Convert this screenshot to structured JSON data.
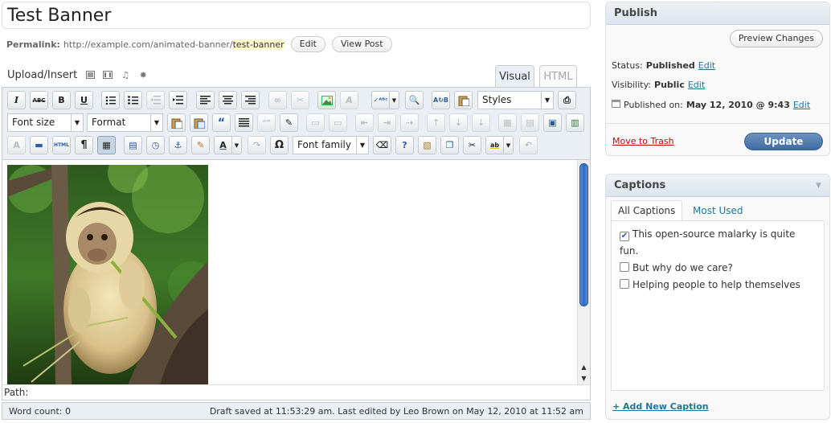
{
  "post": {
    "title": "Test Banner",
    "permalink_label": "Permalink:",
    "permalink_base": "http://example.com/animated-banner/",
    "permalink_slug": "test-banner",
    "edit_label": "Edit",
    "view_post_label": "View Post"
  },
  "editor": {
    "upload_insert_label": "Upload/Insert",
    "tab_visual": "Visual",
    "tab_html": "HTML",
    "styles_label": "Styles",
    "font_size_label": "Font size",
    "format_label": "Format",
    "font_family_label": "Font family",
    "path_label": "Path:",
    "word_count": "Word count: 0",
    "draft_status": "Draft saved at 11:53:29 am. Last edited by Leo Brown on May 12, 2010 at 11:52 am"
  },
  "publish": {
    "title": "Publish",
    "preview_label": "Preview Changes",
    "status_label": "Status:",
    "status_value": "Published",
    "visibility_label": "Visibility:",
    "visibility_value": "Public",
    "published_label": "Published on:",
    "published_value": "May 12, 2010 @ 9:43",
    "edit_label": "Edit",
    "trash_label": "Move to Trash",
    "update_label": "Update"
  },
  "captions": {
    "title": "Captions",
    "tab_all": "All Captions",
    "tab_used": "Most Used",
    "items": [
      {
        "label": "This open-source malarky is quite fun.",
        "checked": true
      },
      {
        "label": "But why do we care?",
        "checked": false
      },
      {
        "label": "Helping people to help themselves",
        "checked": false
      }
    ],
    "add_label": "+ Add New Caption"
  },
  "colors": {
    "link": "#21759b",
    "trash": "#bc0b0b",
    "update_button": "#3f6aa2",
    "toolbar_bg": "#e9eff5"
  }
}
